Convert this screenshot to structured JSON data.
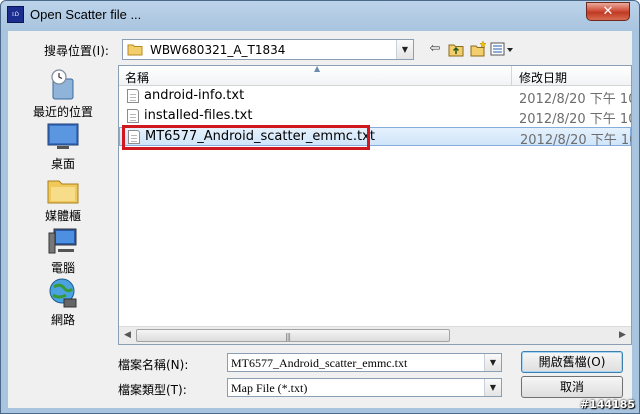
{
  "window": {
    "title": "Open Scatter file ...",
    "icon_text": "ம",
    "close_label": "✕"
  },
  "lookin": {
    "label": "搜尋位置(I):",
    "value": "WBW680321_A_T1834"
  },
  "places": [
    {
      "label": "最近的位置"
    },
    {
      "label": "桌面"
    },
    {
      "label": "媒體櫃"
    },
    {
      "label": "電腦"
    },
    {
      "label": "網路"
    }
  ],
  "columns": {
    "name": "名稱",
    "date": "修改日期"
  },
  "files": [
    {
      "name": "android-info.txt",
      "date": "2012/8/20 下午 10"
    },
    {
      "name": "installed-files.txt",
      "date": "2012/8/20 下午 10"
    },
    {
      "name": "MT6577_Android_scatter_emmc.txt",
      "date": "2012/8/20 下午 10"
    }
  ],
  "filename": {
    "label": "檔案名稱(N):",
    "value": "MT6577_Android_scatter_emmc.txt"
  },
  "filetype": {
    "label": "檔案類型(T):",
    "value": "Map File (*.txt)"
  },
  "buttons": {
    "open": "開啟舊檔(O)",
    "cancel": "取消"
  },
  "watermark": "#144185",
  "colors": {
    "highlight": "#d0181f",
    "selection": "#cfe5fa",
    "title_bg": "#bcd3ea"
  }
}
